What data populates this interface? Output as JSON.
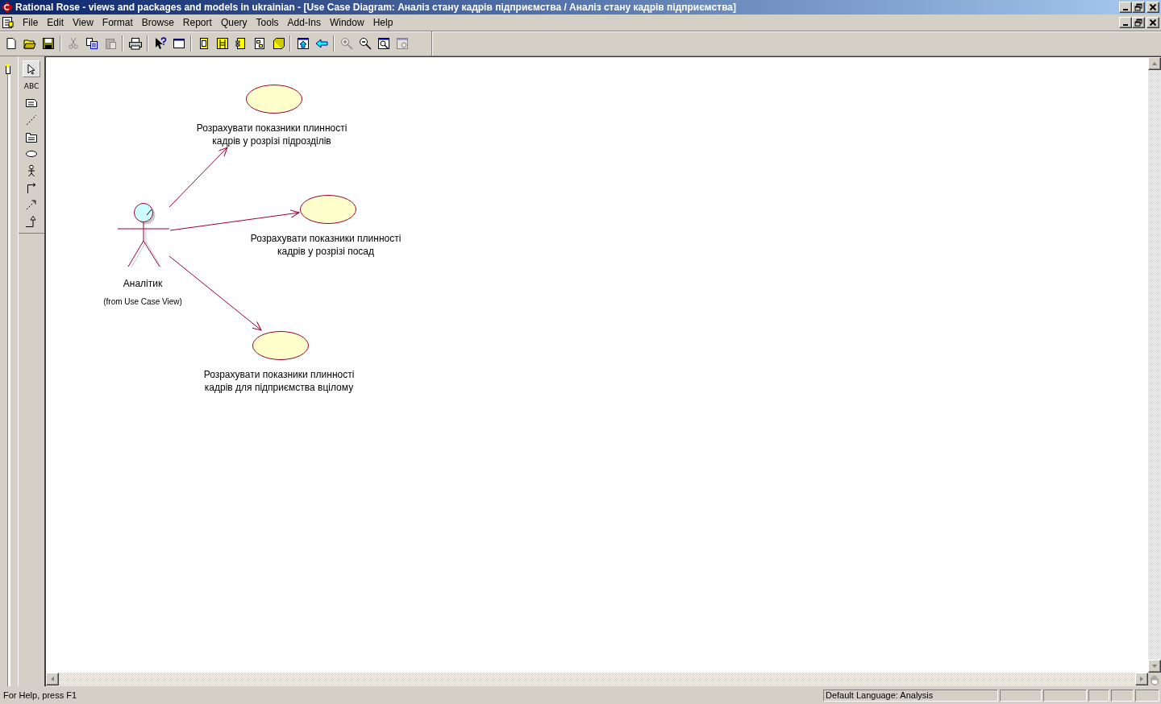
{
  "window": {
    "title": "Rational Rose - views and packages and models in ukrainian - [Use Case Diagram: Аналіз стану кадрів підприємства / Аналіз стану кадрів підприємства]"
  },
  "menu": [
    "File",
    "Edit",
    "View",
    "Format",
    "Browse",
    "Report",
    "Query",
    "Tools",
    "Add-Ins",
    "Window",
    "Help"
  ],
  "toolbar": [
    {
      "kind": "new",
      "disabled": false
    },
    {
      "kind": "open",
      "disabled": false
    },
    {
      "kind": "save",
      "disabled": false
    },
    {
      "kind": "separator"
    },
    {
      "kind": "cut",
      "disabled": true
    },
    {
      "kind": "copy",
      "disabled": false
    },
    {
      "kind": "paste",
      "disabled": true
    },
    {
      "kind": "separator"
    },
    {
      "kind": "print",
      "disabled": false
    },
    {
      "kind": "separator"
    },
    {
      "kind": "help",
      "disabled": false
    },
    {
      "kind": "window",
      "disabled": false
    },
    {
      "kind": "separator"
    },
    {
      "kind": "classdiagram",
      "disabled": false
    },
    {
      "kind": "interaction",
      "disabled": false
    },
    {
      "kind": "component",
      "disabled": false
    },
    {
      "kind": "deployment",
      "disabled": false
    },
    {
      "kind": "module",
      "disabled": false
    },
    {
      "kind": "separator"
    },
    {
      "kind": "parent",
      "disabled": false
    },
    {
      "kind": "back",
      "disabled": false
    },
    {
      "kind": "separator"
    },
    {
      "kind": "zoomin",
      "disabled": true
    },
    {
      "kind": "zoomout",
      "disabled": false
    },
    {
      "kind": "fit",
      "disabled": false
    },
    {
      "kind": "undofit",
      "disabled": true
    }
  ],
  "palette": [
    {
      "kind": "select",
      "selected": true
    },
    {
      "kind": "text",
      "label": "ABC",
      "selected": false
    },
    {
      "kind": "note",
      "selected": false
    },
    {
      "kind": "anchor",
      "selected": false
    },
    {
      "kind": "package",
      "selected": false
    },
    {
      "kind": "usecase",
      "selected": false
    },
    {
      "kind": "actor",
      "selected": false
    },
    {
      "kind": "association",
      "selected": false
    },
    {
      "kind": "dependency",
      "selected": false
    },
    {
      "kind": "generalization",
      "selected": false
    }
  ],
  "diagram": {
    "actor": {
      "name": "Аналітик",
      "origin": "(from Use Case View)"
    },
    "use_cases": [
      {
        "name_lines": [
          "Розрахувати показники плинності",
          "кадрів у розрізі підрозділів"
        ]
      },
      {
        "name_lines": [
          "Розрахувати показники плинності",
          "кадрів у розрізі посад"
        ]
      },
      {
        "name_lines": [
          "Розрахувати показники плинності",
          "кадрів для підприємства вцілому"
        ]
      }
    ]
  },
  "status_bar": {
    "help": "For Help, press F1",
    "language": "Default Language: Analysis"
  }
}
